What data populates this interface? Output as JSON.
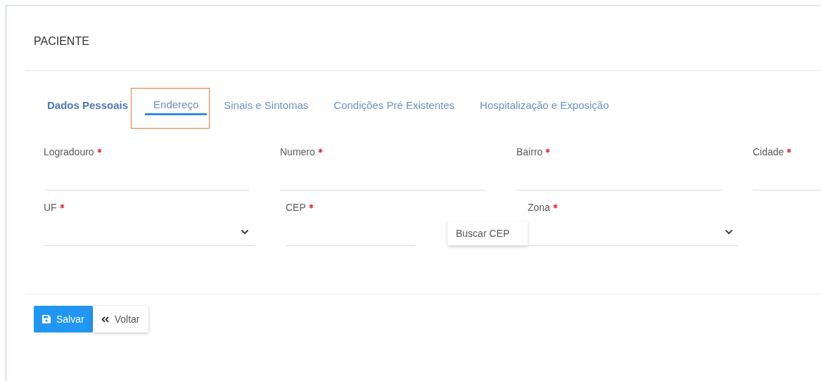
{
  "title": "PACIENTE",
  "tabs": [
    {
      "label": "Dados Pessoais",
      "selected": false,
      "bold": true,
      "highlighted": false
    },
    {
      "label": "Endereço",
      "selected": true,
      "bold": false,
      "highlighted": true
    },
    {
      "label": "Sinais e Sintomas",
      "selected": false,
      "bold": false,
      "highlighted": false
    },
    {
      "label": "Condições Pré Existentes",
      "selected": false,
      "bold": false,
      "highlighted": false
    },
    {
      "label": "Hospitalização e Exposição",
      "selected": false,
      "bold": false,
      "highlighted": false
    }
  ],
  "rows": [
    [
      {
        "kind": "text",
        "label": "Logradouro",
        "required": true
      },
      {
        "kind": "text",
        "label": "Numero",
        "required": true
      },
      {
        "kind": "text",
        "label": "Bairro",
        "required": true
      },
      {
        "kind": "text",
        "label": "Cidade",
        "required": true
      }
    ],
    [
      {
        "kind": "select",
        "label": "UF",
        "required": true
      },
      {
        "kind": "lookup",
        "label": "CEP",
        "required": true,
        "button": "Buscar CEP"
      },
      {
        "kind": "select",
        "label": "Zona",
        "required": true
      }
    ]
  ],
  "buttons": [
    {
      "kind": "save",
      "label": "Salvar"
    },
    {
      "kind": "back",
      "label": "Voltar"
    }
  ]
}
